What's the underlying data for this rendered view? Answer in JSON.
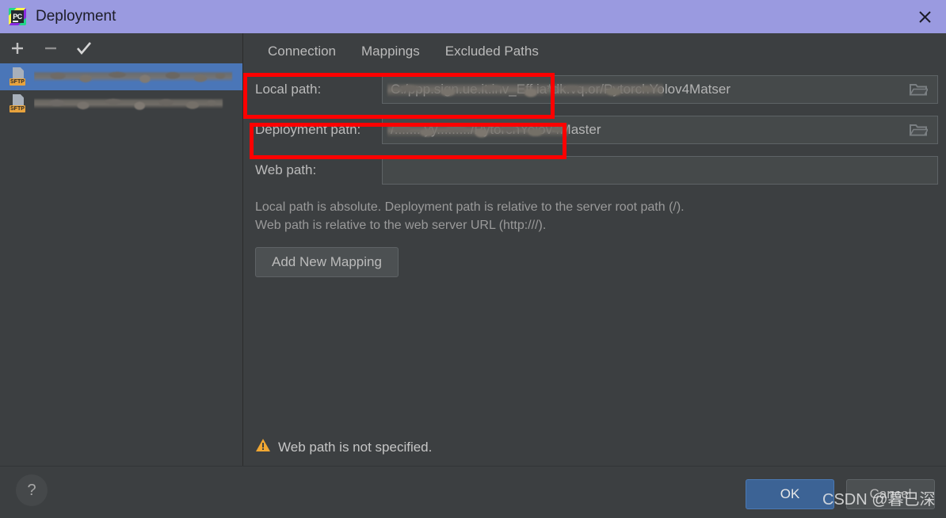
{
  "window": {
    "title": "Deployment",
    "app_icon": "pycharm-icon",
    "close_icon": "close-icon",
    "titlebar_color": "#9a9ae0",
    "background_color": "#3c3f41"
  },
  "sidebar": {
    "toolbar": [
      {
        "name": "add-server-button",
        "icon": "plus-icon"
      },
      {
        "name": "remove-server-button",
        "icon": "minus-icon"
      },
      {
        "name": "set-default-server-button",
        "icon": "check-icon"
      }
    ],
    "servers": [
      {
        "name": "",
        "badge": "SFTP",
        "selected": true,
        "redacted": true,
        "redact_width": 250
      },
      {
        "name": "",
        "badge": "SFTP",
        "selected": false,
        "redacted": true,
        "redact_width": 238
      }
    ],
    "selection_color": "#4a76b8"
  },
  "tabs": [
    {
      "label": "Connection",
      "active": false
    },
    {
      "label": "Mappings",
      "active": true
    },
    {
      "label": "Excluded Paths",
      "active": false
    }
  ],
  "form": {
    "local_path": {
      "label": "Local path:",
      "value": "C:/ppp.sign.ue.it.inv_Eff.ia*dk.vq.or/PytorchYolov4Matser",
      "visible_suffix": "/PytorchYolov4Matser",
      "redacted_prefix_width": 348,
      "browse_icon": "folder-icon"
    },
    "deployment_path": {
      "label": "Deployment path:",
      "value": "/........yy........./PytorchYolov4Master",
      "visible_suffix": "/PytorchYolov4Master",
      "redacted_prefix_width": 228,
      "browse_icon": "folder-icon"
    },
    "web_path": {
      "label": "Web path:",
      "value": "",
      "placeholder": ""
    },
    "hint_line_1": "Local path is absolute. Deployment path is relative to the server root path (/).",
    "hint_line_2": "Web path is relative to the web server URL (http:///).",
    "add_mapping_label": "Add New Mapping"
  },
  "warning": {
    "icon": "warning-triangle-icon",
    "text": "Web path is not specified.",
    "color": "#f0a732"
  },
  "footer": {
    "help_label": "?",
    "ok_label": "OK",
    "cancel_label": "Cancel",
    "ok_color": "#3c6395"
  },
  "annotations": [
    {
      "name": "local-path-highlight",
      "color": "#ff0000"
    },
    {
      "name": "deployment-path-highlight",
      "color": "#ff0000"
    }
  ],
  "watermark": {
    "text": "CSDN @暮已深"
  }
}
